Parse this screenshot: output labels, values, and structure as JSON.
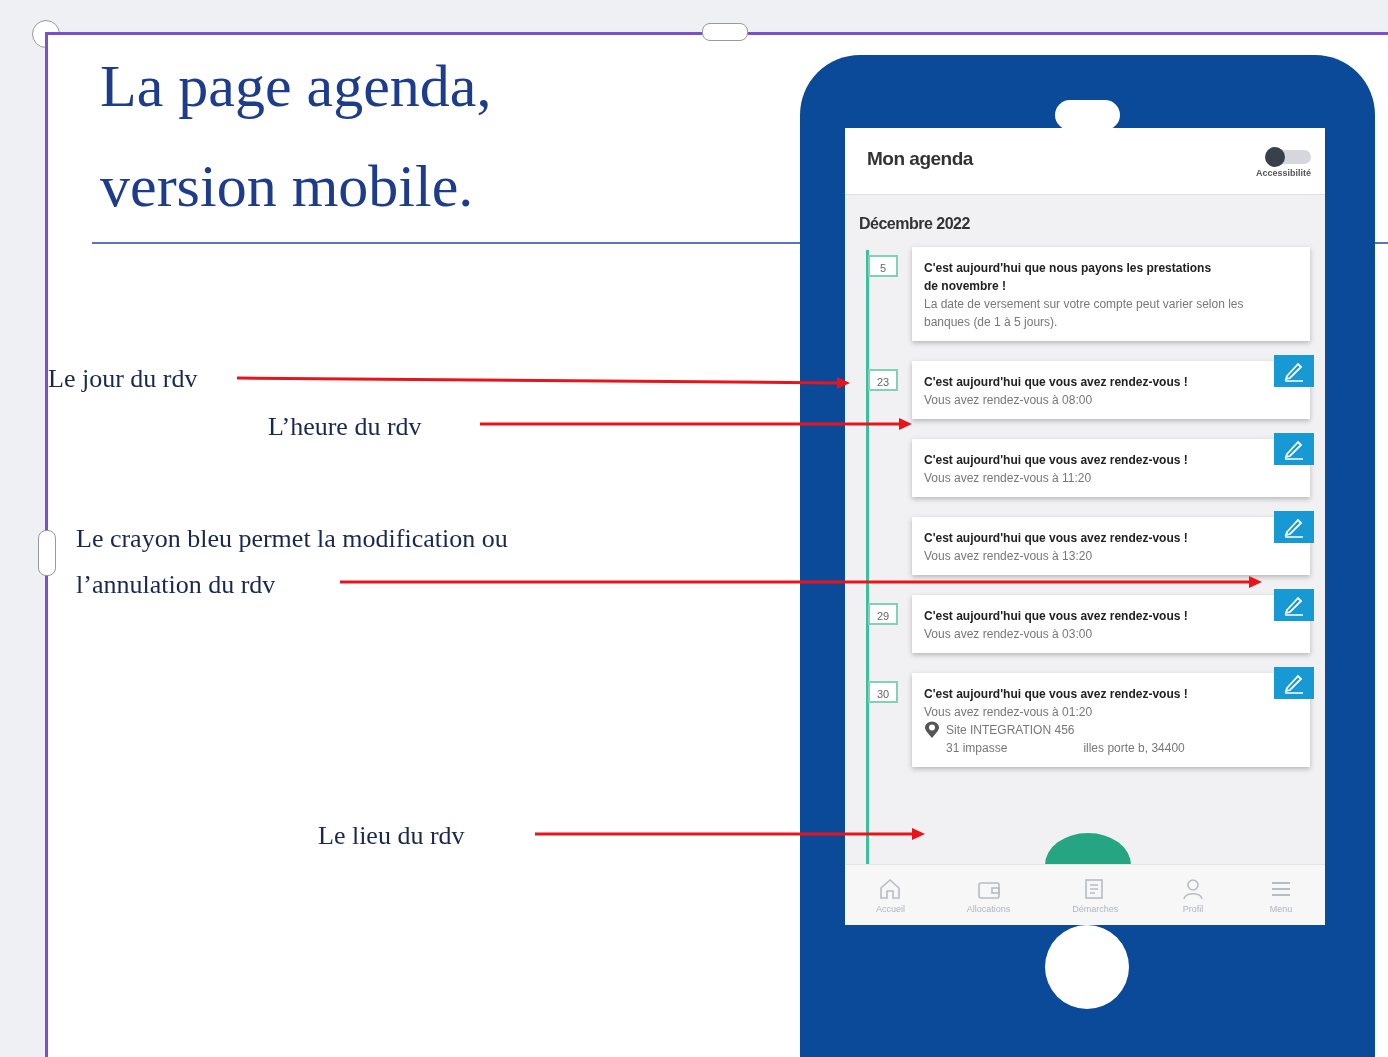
{
  "slide": {
    "title_lines": [
      "La page agenda,",
      "version mobile."
    ],
    "annotations": [
      {
        "lines": [
          "Le jour du rdv"
        ]
      },
      {
        "lines": [
          "L’heure du rdv"
        ]
      },
      {
        "lines": [
          "Le crayon bleu permet la modification ou",
          "l’annulation du rdv"
        ]
      },
      {
        "lines": [
          "Le lieu du rdv"
        ]
      }
    ]
  },
  "phone": {
    "header": {
      "title": "Mon agenda",
      "toggle_label": "Accessibilité",
      "on": false
    },
    "month": "Décembre 2022",
    "events": [
      {
        "day": "5",
        "title": "C'est aujourd'hui que nous payons les prestations de novembre !",
        "body": "La date de versement sur votre compte peut varier selon les banques (de 1 à 5 jours).",
        "editable": false
      },
      {
        "day": "23",
        "title": "C'est aujourd'hui que vous avez rendez-vous !",
        "body": "Vous avez rendez-vous à 08:00",
        "editable": true
      },
      {
        "title": "C'est aujourd'hui que vous avez rendez-vous !",
        "body": "Vous avez rendez-vous à 11:20",
        "editable": true
      },
      {
        "title": "C'est aujourd'hui que vous avez rendez-vous !",
        "body": "Vous avez rendez-vous à 13:20",
        "editable": true
      },
      {
        "day": "29",
        "title": "C'est aujourd'hui que vous avez rendez-vous !",
        "body": "Vous avez rendez-vous à 03:00",
        "editable": true
      },
      {
        "day": "30",
        "title": "C'est aujourd'hui que vous avez rendez-vous !",
        "body": "Vous avez rendez-vous à 01:20",
        "editable": true,
        "location": {
          "site": "Site INTEGRATION 456",
          "address_parts": [
            "31 impasse",
            "illes porte b, 34400"
          ]
        }
      }
    ],
    "nav": [
      "Accueil",
      "Allocations",
      "Démarches",
      "Profil",
      "Menu"
    ]
  }
}
